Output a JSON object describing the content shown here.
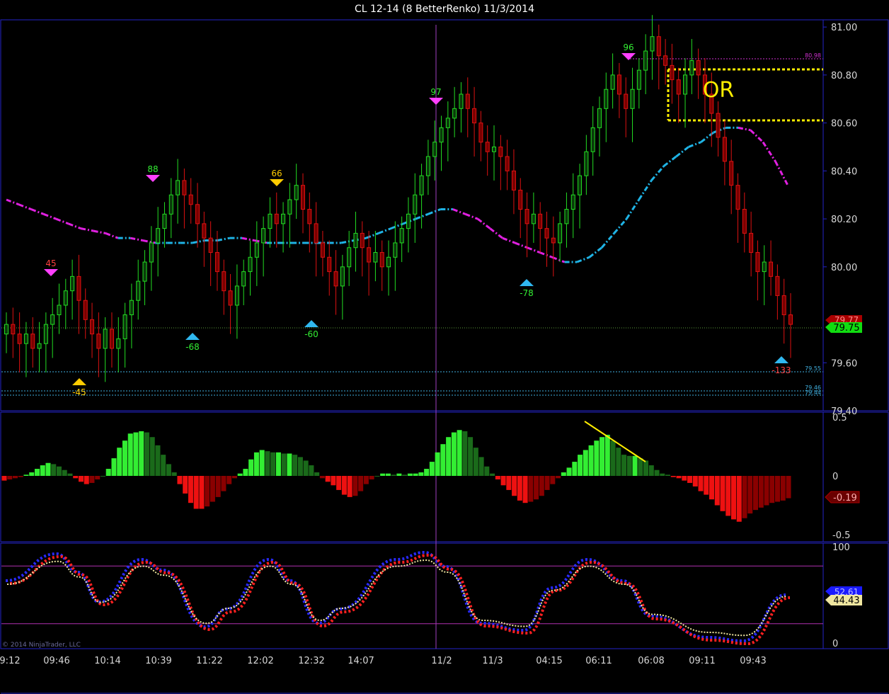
{
  "window": {
    "title": "CL 12-14 (8 BetterRenko)  11/3/2014"
  },
  "copyright": "© 2014 NinjaTrader, LLC",
  "colors": {
    "background": "#000000",
    "frame": "#2323c8",
    "bull": "#22dd22",
    "bear": "#dd1111",
    "ema_up": "#1fb4e6",
    "ema_down": "#e020e0",
    "or_box": "#ffee00"
  },
  "chart_data": [
    {
      "panel": "price",
      "type": "candlestick",
      "instrument": "CL 12-14",
      "bar_type": "8 BetterRenko",
      "date": "11/3/2014",
      "x_ticks": [
        "9:12",
        "09:46",
        "10:14",
        "10:39",
        "11:22",
        "12:02",
        "12:32",
        "14:07",
        "11/2",
        "11/3",
        "04:15",
        "06:11",
        "06:08",
        "09:11",
        "09:43"
      ],
      "y_ticks": [
        "81.00",
        "80.80",
        "80.60",
        "80.40",
        "80.20",
        "80.00",
        "79.60",
        "79.40"
      ],
      "ylim": [
        79.4,
        81.03
      ],
      "close": [
        79.76,
        79.72,
        79.68,
        79.72,
        79.66,
        79.68,
        79.76,
        79.8,
        79.84,
        79.9,
        79.96,
        79.86,
        79.78,
        79.72,
        79.66,
        79.74,
        79.66,
        79.7,
        79.8,
        79.86,
        79.94,
        80.02,
        80.1,
        80.16,
        80.22,
        80.3,
        80.36,
        80.3,
        80.26,
        80.18,
        80.12,
        80.06,
        79.98,
        79.9,
        79.84,
        79.92,
        79.98,
        80.04,
        80.1,
        80.16,
        80.22,
        80.18,
        80.22,
        80.28,
        80.34,
        80.24,
        80.18,
        80.1,
        80.04,
        79.98,
        79.92,
        80.0,
        80.08,
        80.14,
        80.08,
        80.02,
        80.06,
        80.0,
        80.04,
        80.1,
        80.16,
        80.22,
        80.3,
        80.38,
        80.46,
        80.52,
        80.58,
        80.62,
        80.66,
        80.72,
        80.66,
        80.6,
        80.52,
        80.48,
        80.5,
        80.46,
        80.4,
        80.32,
        80.24,
        80.18,
        80.22,
        80.16,
        80.12,
        80.1,
        80.18,
        80.24,
        80.3,
        80.38,
        80.48,
        80.58,
        80.66,
        80.74,
        80.8,
        80.72,
        80.66,
        80.74,
        80.82,
        80.9,
        80.96,
        80.88,
        80.84,
        80.78,
        80.72,
        80.8,
        80.86,
        80.8,
        80.72,
        80.64,
        80.54,
        80.44,
        80.34,
        80.24,
        80.14,
        80.06,
        79.98,
        80.02,
        79.96,
        79.88,
        79.8,
        79.76
      ],
      "ema_fast": [
        80.28,
        80.26,
        80.24,
        80.22,
        80.2,
        80.18,
        80.16,
        80.15,
        80.14,
        80.12,
        80.12,
        80.11,
        80.1,
        80.1,
        80.1,
        80.1,
        80.11,
        80.11,
        80.12,
        80.12,
        80.11,
        80.1,
        80.1,
        80.1,
        80.1,
        80.1,
        80.1,
        80.1,
        80.11,
        80.12,
        80.14,
        80.16,
        80.18,
        80.2,
        80.22,
        80.24,
        80.24,
        80.22,
        80.2,
        80.16,
        80.12,
        80.1,
        80.08,
        80.06,
        80.04,
        80.02,
        80.02,
        80.04,
        80.08,
        80.14,
        80.2,
        80.28,
        80.36,
        80.42,
        80.46,
        80.5,
        80.52,
        80.56,
        80.58,
        80.58,
        80.57,
        80.52,
        80.44,
        80.34
      ]
    },
    {
      "panel": "momentum_histogram",
      "type": "bar",
      "ylim": [
        -0.5,
        0.5
      ],
      "y_ticks": [
        "0.5",
        "0",
        "-0.5"
      ],
      "current_value_label": "-0.19",
      "values": [
        -0.04,
        -0.03,
        -0.02,
        -0.01,
        0.01,
        0.03,
        0.06,
        0.09,
        0.11,
        0.1,
        0.08,
        0.05,
        0.02,
        -0.02,
        -0.05,
        -0.07,
        -0.06,
        -0.03,
        0.0,
        0.06,
        0.15,
        0.24,
        0.3,
        0.36,
        0.37,
        0.38,
        0.37,
        0.33,
        0.26,
        0.18,
        0.1,
        0.03,
        -0.07,
        -0.15,
        -0.23,
        -0.28,
        -0.28,
        -0.26,
        -0.22,
        -0.18,
        -0.13,
        -0.07,
        -0.02,
        0.02,
        0.06,
        0.14,
        0.2,
        0.22,
        0.21,
        0.2,
        0.2,
        0.19,
        0.19,
        0.18,
        0.16,
        0.13,
        0.09,
        0.03,
        -0.02,
        -0.05,
        -0.08,
        -0.12,
        -0.16,
        -0.18,
        -0.17,
        -0.13,
        -0.07,
        -0.03,
        0.0,
        0.02,
        0.02,
        0.01,
        0.02,
        0.01,
        0.02,
        0.02,
        0.03,
        0.06,
        0.12,
        0.2,
        0.27,
        0.33,
        0.37,
        0.39,
        0.38,
        0.33,
        0.24,
        0.16,
        0.08,
        0.02,
        -0.03,
        -0.08,
        -0.12,
        -0.17,
        -0.21,
        -0.23,
        -0.22,
        -0.2,
        -0.17,
        -0.12,
        -0.07,
        -0.02,
        0.03,
        0.07,
        0.12,
        0.18,
        0.22,
        0.26,
        0.3,
        0.33,
        0.35,
        0.3,
        0.24,
        0.18,
        0.17,
        0.17,
        0.15,
        0.13,
        0.09,
        0.05,
        0.02,
        0.01,
        -0.01,
        -0.02,
        -0.04,
        -0.06,
        -0.09,
        -0.13,
        -0.16,
        -0.2,
        -0.25,
        -0.3,
        -0.34,
        -0.37,
        -0.39,
        -0.36,
        -0.32,
        -0.29,
        -0.27,
        -0.25,
        -0.23,
        -0.22,
        -0.21,
        -0.19
      ]
    },
    {
      "panel": "oscillator",
      "type": "line",
      "ylim": [
        0,
        100
      ],
      "y_ticks": [
        "100",
        "0"
      ],
      "levels": [
        80,
        20
      ],
      "current_value_labels": [
        "52.61",
        "44.43"
      ]
    }
  ],
  "annotations": {
    "swing_labels": [
      "45",
      "88",
      "66",
      "97",
      "96",
      "-45",
      "-68",
      "-60",
      "-78",
      "-133"
    ],
    "price_labels": [
      "80.98",
      "79.55",
      "79.46",
      "79.44"
    ],
    "right_tags": [
      "79.77",
      "79.75"
    ],
    "or_label": "OR"
  }
}
